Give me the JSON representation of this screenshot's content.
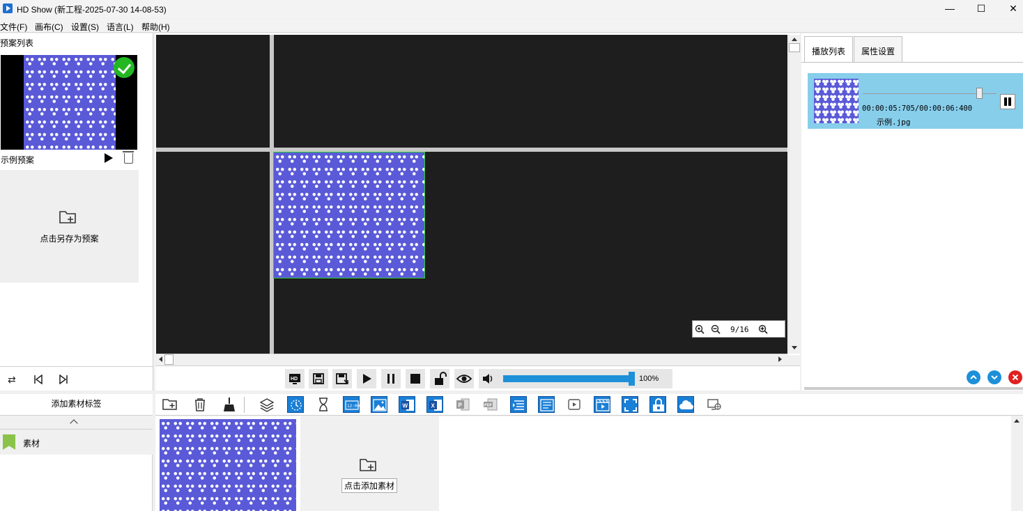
{
  "window": {
    "title": "HD Show (新工程-2025-07-30 14-08-53)",
    "minimize": "—",
    "maximize": "☐",
    "close": "✕"
  },
  "menu": [
    "文件(F)",
    "画布(C)",
    "设置(S)",
    "语言(L)",
    "帮助(H)"
  ],
  "preset_panel": {
    "header": "预案列表",
    "preset_name": "示例预案",
    "save_as_label": "点击另存为预案"
  },
  "canvas": {
    "zoom_text": "9/16"
  },
  "volume": {
    "value_text": "100%",
    "level_fraction": 1.0
  },
  "right_panel": {
    "tabs": [
      "播放列表",
      "属性设置"
    ],
    "playlist": [
      {
        "time": "00:00:05:705/00:00:06:400",
        "name": "示例.jpg",
        "progress_fraction": 0.88
      }
    ]
  },
  "tags_panel": {
    "add_tag_label": "添加素材标签",
    "tags": [
      "素材"
    ]
  },
  "material_area": {
    "add_material_label": "点击添加素材"
  },
  "colors": {
    "accent": "#1e90d9",
    "playlist_bg": "#87ceeb",
    "canvas_bg": "#1e1e1e",
    "image_blue": "#5a5ad8"
  }
}
